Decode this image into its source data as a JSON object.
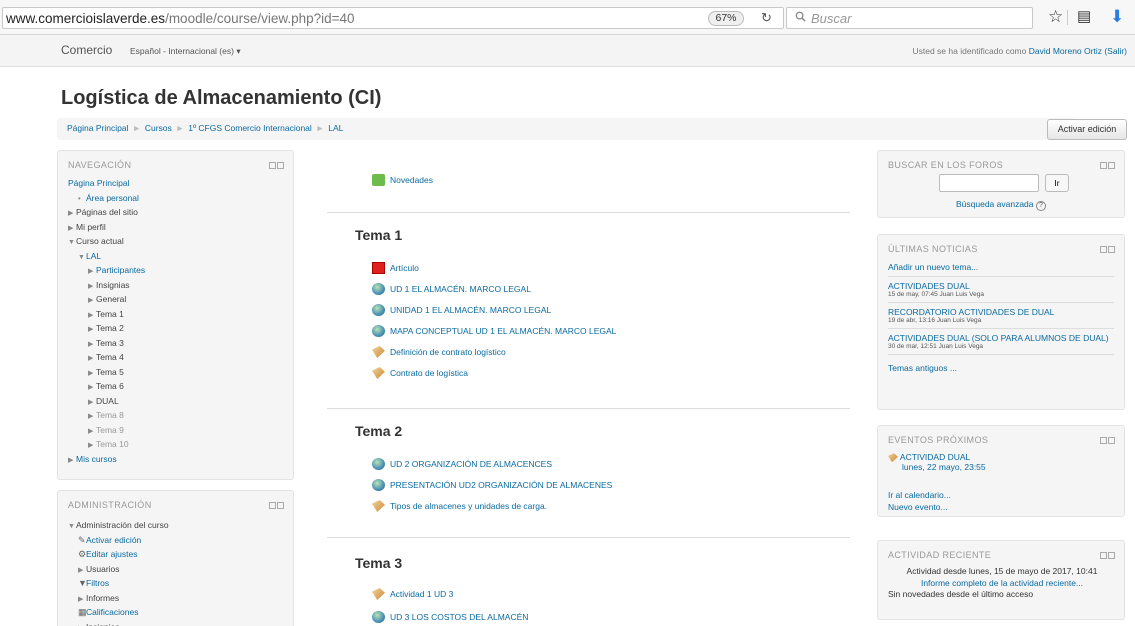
{
  "browser": {
    "url_host": "www.comercioislaverde.es",
    "url_path": "/moodle/course/view.php?id=40",
    "zoom": "67%",
    "search_placeholder": "Buscar"
  },
  "header": {
    "brand": "Comercio",
    "language": "Español - Internacional (es)",
    "login_prefix": "Usted se ha identificado como",
    "user_name": "David Moreno Ortiz",
    "logout": "(Salir)"
  },
  "course": {
    "title": "Logística de Almacenamiento (CI)",
    "edit_button": "Activar edición"
  },
  "breadcrumb": [
    "Página Principal",
    "Cursos",
    "1º CFGS Comercio Internacional",
    "LAL"
  ],
  "navigation": {
    "title": "NAVEGACIÓN",
    "items": [
      {
        "label": "Página Principal",
        "marker": "",
        "indent": 0,
        "muted": false
      },
      {
        "label": "Área personal",
        "marker": "dot",
        "indent": 1,
        "muted": false
      },
      {
        "label": "Páginas del sitio",
        "marker": "right",
        "indent": 0,
        "muted": false,
        "dark": true
      },
      {
        "label": "Mi perfil",
        "marker": "right",
        "indent": 0,
        "muted": false,
        "dark": true
      },
      {
        "label": "Curso actual",
        "marker": "down",
        "indent": 0,
        "muted": false,
        "dark": true
      },
      {
        "label": "LAL",
        "marker": "down",
        "indent": 1,
        "muted": false
      },
      {
        "label": "Participantes",
        "marker": "right",
        "indent": 2,
        "muted": false
      },
      {
        "label": "Insignias",
        "marker": "right",
        "indent": 2,
        "muted": false,
        "dark": true
      },
      {
        "label": "General",
        "marker": "right",
        "indent": 2,
        "muted": false,
        "dark": true
      },
      {
        "label": "Tema 1",
        "marker": "right",
        "indent": 2,
        "muted": false,
        "dark": true
      },
      {
        "label": "Tema 2",
        "marker": "right",
        "indent": 2,
        "muted": false,
        "dark": true
      },
      {
        "label": "Tema 3",
        "marker": "right",
        "indent": 2,
        "muted": false,
        "dark": true
      },
      {
        "label": "Tema 4",
        "marker": "right",
        "indent": 2,
        "muted": false,
        "dark": true
      },
      {
        "label": "Tema 5",
        "marker": "right",
        "indent": 2,
        "muted": false,
        "dark": true
      },
      {
        "label": "Tema 6",
        "marker": "right",
        "indent": 2,
        "muted": false,
        "dark": true
      },
      {
        "label": "DUAL",
        "marker": "right",
        "indent": 2,
        "muted": false,
        "dark": true
      },
      {
        "label": "Tema 8",
        "marker": "right",
        "indent": 2,
        "muted": true
      },
      {
        "label": "Tema 9",
        "marker": "right",
        "indent": 2,
        "muted": true
      },
      {
        "label": "Tema 10",
        "marker": "right",
        "indent": 2,
        "muted": true
      },
      {
        "label": "Mis cursos",
        "marker": "right",
        "indent": 0,
        "muted": false
      }
    ]
  },
  "admin": {
    "title": "ADMINISTRACIÓN",
    "items": [
      {
        "label": "Administración del curso",
        "marker": "down",
        "indent": 0,
        "dark": true
      },
      {
        "label": "Activar edición",
        "marker": "pencil",
        "indent": 1
      },
      {
        "label": "Editar ajustes",
        "marker": "gear",
        "indent": 1
      },
      {
        "label": "Usuarios",
        "marker": "right",
        "indent": 1,
        "dark": true
      },
      {
        "label": "Filtros",
        "marker": "funnel",
        "indent": 1
      },
      {
        "label": "Informes",
        "marker": "right",
        "indent": 1,
        "dark": true
      },
      {
        "label": "Calificaciones",
        "marker": "grid",
        "indent": 1
      },
      {
        "label": "Insignias",
        "marker": "right",
        "indent": 1,
        "dark": true
      }
    ]
  },
  "main": {
    "news": "Novedades",
    "sections": [
      {
        "title": "Tema 1",
        "items": [
          {
            "label": "Artículo",
            "icon": "pdf"
          },
          {
            "label": "UD 1 EL ALMACÉN. MARCO LEGAL",
            "icon": "globe"
          },
          {
            "label": "UNIDAD 1 EL ALMACÉN. MARCO LEGAL",
            "icon": "globe"
          },
          {
            "label": "MAPA CONCEPTUAL UD 1 EL ALMACÉN. MARCO LEGAL",
            "icon": "globe"
          },
          {
            "label": "Definición de contrato logístico",
            "icon": "file"
          },
          {
            "label": "Contrato de logística",
            "icon": "file"
          }
        ]
      },
      {
        "title": "Tema 2",
        "items": [
          {
            "label": "UD 2 ORGANIZACIÓN DE ALMACENCES",
            "icon": "globe"
          },
          {
            "label": "PRESENTACIÓN UD2 ORGANIZACIÓN DE ALMACENES",
            "icon": "globe"
          },
          {
            "label": "Tipos de almacenes y unidades de carga.",
            "icon": "file"
          }
        ]
      },
      {
        "title": "Tema 3",
        "items": [
          {
            "label": "Actividad 1 UD 3",
            "icon": "file"
          },
          {
            "label": "UD 3 LOS COSTOS DEL ALMACÉN",
            "icon": "globe"
          }
        ]
      }
    ]
  },
  "forum_search": {
    "title": "BUSCAR EN LOS FOROS",
    "go": "Ir",
    "advanced": "Búsqueda avanzada"
  },
  "latest_news": {
    "title": "ÚLTIMAS NOTICIAS",
    "add": "Añadir un nuevo tema...",
    "items": [
      {
        "title": "ACTIVIDADES DUAL",
        "meta": "15 de may, 07:45  Juan Luis Vega"
      },
      {
        "title": "RECORDATORIO ACTIVIDADES DE DUAL",
        "meta": "19 de abr, 13:16  Juan Luis Vega"
      },
      {
        "title": "ACTIVIDADES DUAL (SOLO PARA ALUMNOS DE DUAL)",
        "meta": "30 de mar, 12:51  Juan Luis Vega"
      }
    ],
    "older": "Temas antiguos ..."
  },
  "upcoming": {
    "title": "EVENTOS PRÓXIMOS",
    "event_title": "ACTIVIDAD DUAL",
    "event_date": "lunes, 22 mayo, 23:55",
    "calendar": "Ir al calendario...",
    "new_event": "Nuevo evento..."
  },
  "recent": {
    "title": "ACTIVIDAD RECIENTE",
    "since": "Actividad desde lunes, 15 de mayo de 2017, 10:41",
    "report": "Informe completo de la actividad reciente...",
    "none": "Sin novedades desde el último acceso"
  }
}
